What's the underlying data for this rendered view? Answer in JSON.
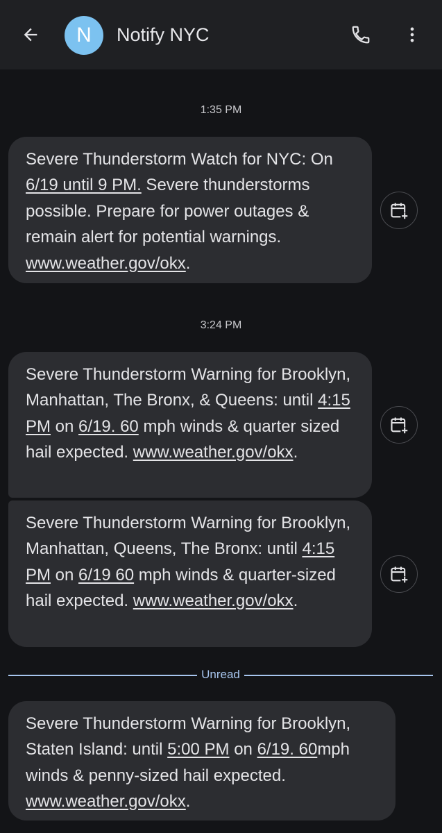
{
  "header": {
    "avatar_letter": "N",
    "contact_name": "Notify NYC",
    "back_icon": "arrow-back-icon",
    "call_icon": "phone-icon",
    "more_icon": "more-vert-icon"
  },
  "groups": [
    {
      "timestamp": "1:35 PM",
      "messages": [
        {
          "p1": "Severe Thunderstorm Watch for NYC: On ",
          "l1": "6/19 until 9 PM.",
          "p2": " Severe thunderstorms possible. Prepare for power outages & remain alert for potential warnings. ",
          "link": "www.weather.gov/okx",
          "end": "."
        }
      ]
    },
    {
      "timestamp": "3:24 PM",
      "messages": [
        {
          "p1": "Severe Thunderstorm Warning for Brooklyn, Manhattan, The Bronx, & Queens: until ",
          "l1": "4:15 PM",
          "p2": " on ",
          "l2": "6/19. 60",
          "p3": " mph winds & quarter sized hail expected. ",
          "link": "www.weather.gov/okx",
          "end": "."
        },
        {
          "p1": "Severe Thunderstorm Warning for Brooklyn, Manhattan, Queens, The Bronx: until ",
          "l1": "4:15 PM",
          "p2": " on ",
          "l2": "6/19 60",
          "p3": " mph winds & quarter-sized hail expected. ",
          "link": "www.weather.gov/okx",
          "end": "."
        }
      ]
    }
  ],
  "divider_label": "Unread",
  "unread_message": {
    "p1": "Severe Thunderstorm Warning for Brooklyn, Staten Island: until ",
    "l1": "5:00 PM",
    "p2": " on ",
    "l2": "6/19. 60",
    "p3": "mph winds & penny-sized hail expected. ",
    "link": "www.weather.gov/okx",
    "end": "."
  },
  "calendar_icon": "calendar-add-icon",
  "colors": {
    "app_bar": "#1f2023",
    "background": "#131417",
    "bubble": "#2c2d31",
    "avatar": "#7cc2f0",
    "unread_accent": "#a7c5ee"
  }
}
